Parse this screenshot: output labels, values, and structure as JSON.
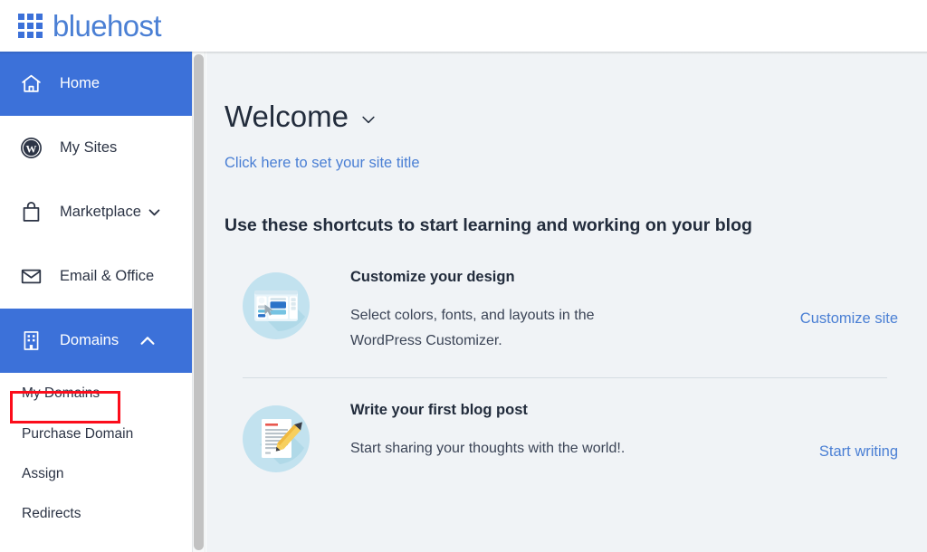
{
  "brand": {
    "name": "bluehost",
    "logo_icon": "grid-3x3-icon",
    "color": "#4a7fd4",
    "accent": "#3c71d9"
  },
  "sidebar": {
    "items": [
      {
        "label": "Home",
        "icon": "home-icon",
        "active": true,
        "chevron": null
      },
      {
        "label": "My Sites",
        "icon": "wordpress-icon",
        "active": false,
        "chevron": null
      },
      {
        "label": "Marketplace",
        "icon": "shopping-bag-icon",
        "active": false,
        "chevron": "chevron-down-icon"
      },
      {
        "label": "Email & Office",
        "icon": "envelope-icon",
        "active": false,
        "chevron": null
      },
      {
        "label": "Domains",
        "icon": "building-icon",
        "active": true,
        "chevron": "chevron-up-icon"
      }
    ],
    "sub_items": [
      {
        "label": "My Domains",
        "highlighted": true
      },
      {
        "label": "Purchase Domain",
        "highlighted": false
      },
      {
        "label": "Assign",
        "highlighted": false
      },
      {
        "label": "Redirects",
        "highlighted": false
      }
    ],
    "highlight_color": "#fc0d1b"
  },
  "main": {
    "welcome_title": "Welcome",
    "welcome_chevron_icon": "chevron-down-icon",
    "site_title_link": "Click here to set your site title",
    "section_heading": "Use these shortcuts to start learning and working on your blog",
    "cards": [
      {
        "icon": "browser-design-icon",
        "title": "Customize your design",
        "description": "Select colors, fonts, and layouts in the WordPress Customizer.",
        "action": "Customize site"
      },
      {
        "icon": "document-pencil-icon",
        "title": "Write your first blog post",
        "description": "Start sharing your thoughts with the world!.",
        "action": "Start writing"
      }
    ]
  }
}
